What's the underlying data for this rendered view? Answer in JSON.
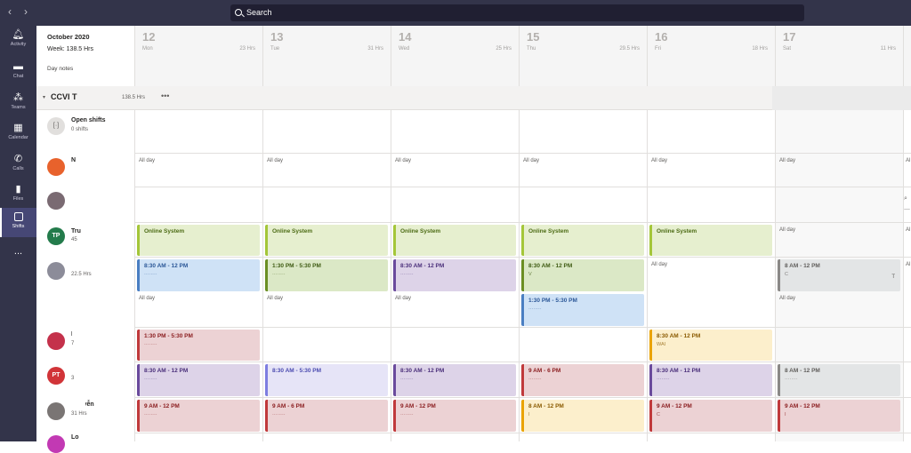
{
  "search": {
    "label": "Search"
  },
  "colors": {
    "brand": "#33344a",
    "green": "#a4c639",
    "blue": "#4a7ec2",
    "purple": "#6a4a9c",
    "red": "#c0393b",
    "yellow": "#eaa300",
    "gray": "#8a8886",
    "lavender": "#7d7de0",
    "olive": "#6b8e23"
  },
  "rail": [
    {
      "label": "Activity",
      "icon": "bell-icon"
    },
    {
      "label": "Chat",
      "icon": "chat-icon"
    },
    {
      "label": "Teams",
      "icon": "teams-icon"
    },
    {
      "label": "Calendar",
      "icon": "calendar-icon"
    },
    {
      "label": "Calls",
      "icon": "phone-icon"
    },
    {
      "label": "Files",
      "icon": "file-icon"
    },
    {
      "label": "Shifts",
      "icon": "shifts-icon"
    },
    {
      "label": "...",
      "icon": "more-icon"
    }
  ],
  "header": {
    "month": "October 2020",
    "week": "Week: 138.5 Hrs",
    "day_notes": "Day notes"
  },
  "days": [
    {
      "num": "12",
      "name": "Mon",
      "hrs": "23 Hrs"
    },
    {
      "num": "13",
      "name": "Tue",
      "hrs": "31 Hrs"
    },
    {
      "num": "14",
      "name": "Wed",
      "hrs": "25 Hrs"
    },
    {
      "num": "15",
      "name": "Thu",
      "hrs": "29.5 Hrs"
    },
    {
      "num": "16",
      "name": "Fri",
      "hrs": "18 Hrs"
    },
    {
      "num": "17",
      "name": "Sat",
      "hrs": "11 Hrs"
    }
  ],
  "group": {
    "title": "CCVI T",
    "hrs": "138.5 Hrs",
    "more": "•••"
  },
  "open_shifts": {
    "title": "Open shifts",
    "count": "0 shifts"
  },
  "all_day": "All day",
  "people": [
    {
      "name": "N",
      "hrs": ""
    },
    {
      "name": "",
      "hrs": ""
    },
    {
      "initials": "TP",
      "name": "Tru",
      "hrs": "45"
    },
    {
      "name": "",
      "hrs": "22.5 Hrs"
    },
    {
      "name": "Lê",
      "hrs": "7"
    },
    {
      "initials": "PT",
      "name": "",
      "hrs": "3"
    },
    {
      "name": "Nguyễn",
      "hrs": "31 Hrs"
    },
    {
      "name": "Lo",
      "hrs": ""
    }
  ],
  "shifts": {
    "online": "Online System",
    "a": "8:30 AM - 12 PM",
    "b": "1:30 PM - 5:30 PM",
    "c": "8:30 AM - 5:30 PM",
    "d": "9 AM - 12 PM",
    "e": "9 AM - 6 PM",
    "f": "8 AM - 12 PM",
    "v": "V",
    "w": "WAI",
    "i": "I",
    "c_letter": "C",
    "t_letter": "T"
  }
}
